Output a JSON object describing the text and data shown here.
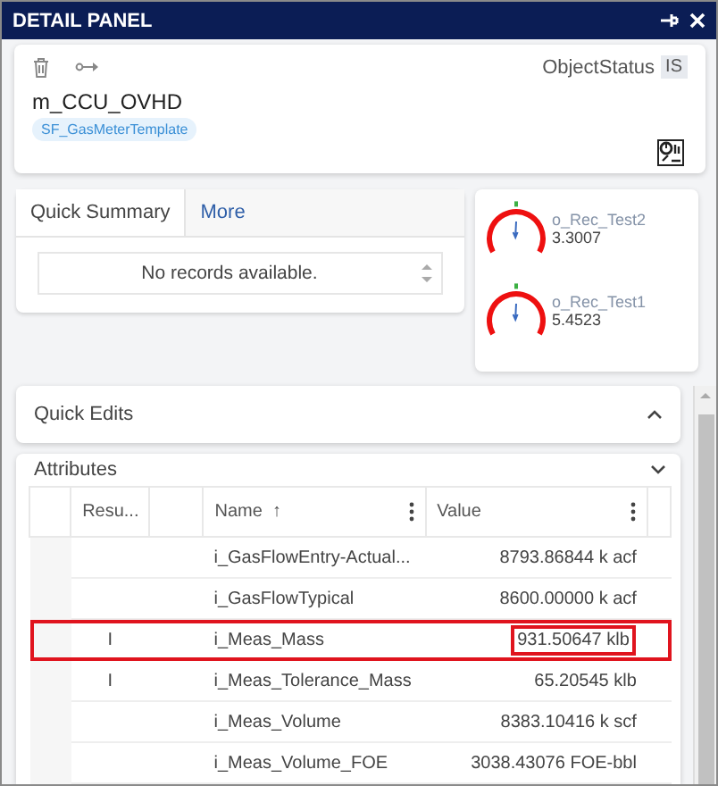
{
  "window": {
    "title": "DETAIL PANEL"
  },
  "header": {
    "status_label": "ObjectStatus",
    "status_value": "IS",
    "object_name": "m_CCU_OVHD",
    "template_tag": "SF_GasMeterTemplate"
  },
  "tabs": [
    {
      "label": "Quick Summary",
      "selected": true
    },
    {
      "label": "More",
      "selected": false
    }
  ],
  "summary": {
    "empty_text": "No records available."
  },
  "gauges": [
    {
      "name": "o_Rec_Test2",
      "value": "3.3007"
    },
    {
      "name": "o_Rec_Test1",
      "value": "5.4523"
    }
  ],
  "sections": [
    {
      "title": "Quick Edits",
      "expanded": true
    },
    {
      "title": "Attributes",
      "expanded": false
    }
  ],
  "table": {
    "columns": [
      {
        "label": "Resu..."
      },
      {
        "label": "Name",
        "sort": "↑"
      },
      {
        "label": "Value"
      }
    ],
    "rows": [
      {
        "result": "",
        "name": "i_GasFlowEntry-Actual...",
        "value": "8793.86844 k acf",
        "highlighted": false
      },
      {
        "result": "",
        "name": "i_GasFlowTypical",
        "value": "8600.00000 k acf",
        "highlighted": false
      },
      {
        "result": "I",
        "name": "i_Meas_Mass",
        "value": "931.50647 klb",
        "highlighted": true
      },
      {
        "result": "I",
        "name": "i_Meas_Tolerance_Mass",
        "value": "65.20545 klb",
        "highlighted": false
      },
      {
        "result": "",
        "name": "i_Meas_Volume",
        "value": "8383.10416 k scf",
        "highlighted": false
      },
      {
        "result": "",
        "name": "i_Meas_Volume_FOE",
        "value": "3038.43076 FOE-bbl",
        "highlighted": false
      }
    ]
  }
}
